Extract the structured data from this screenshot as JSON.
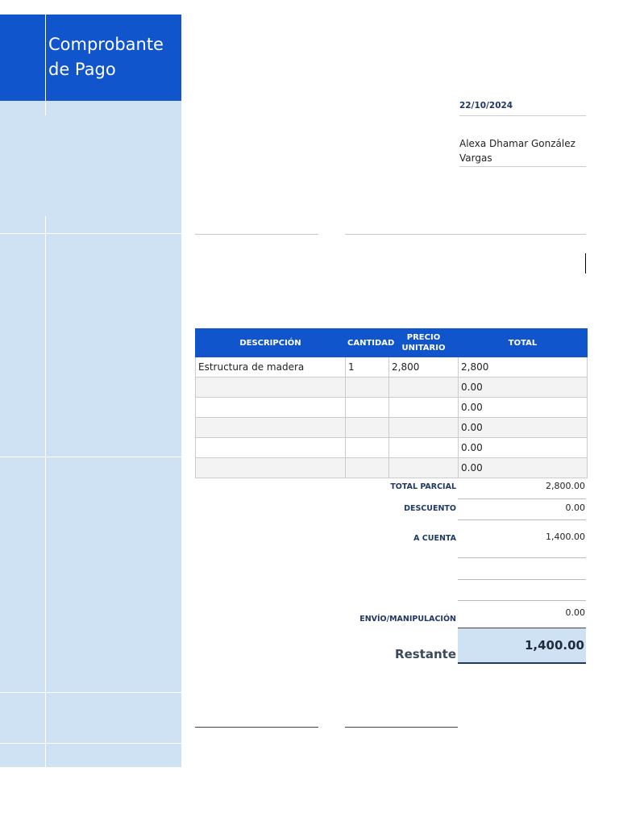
{
  "sidebar": {
    "title": "Comprobante de Pago"
  },
  "header": {
    "date": "22/10/2024",
    "customer_name": "Alexa Dhamar González Vargas"
  },
  "items_table": {
    "columns": [
      "DESCRIPCIÓN",
      "CANTIDAD",
      "PRECIO UNITARIO",
      "TOTAL"
    ],
    "rows": [
      {
        "description": "Estructura de madera",
        "quantity": "1",
        "unit_price": "2,800",
        "total": "2,800"
      },
      {
        "description": "",
        "quantity": "",
        "unit_price": "",
        "total": "0.00"
      },
      {
        "description": "",
        "quantity": "",
        "unit_price": "",
        "total": "0.00"
      },
      {
        "description": "",
        "quantity": "",
        "unit_price": "",
        "total": "0.00"
      },
      {
        "description": "",
        "quantity": "",
        "unit_price": "",
        "total": "0.00"
      },
      {
        "description": "",
        "quantity": "",
        "unit_price": "",
        "total": "0.00"
      }
    ]
  },
  "summary": {
    "subtotal_label": "TOTAL PARCIAL",
    "subtotal_value": "2,800.00",
    "discount_label": "DESCUENTO",
    "discount_value": "0.00",
    "on_account_label": "A CUENTA",
    "on_account_value": "1,400.00",
    "shipping_label": "ENVÍO/MANIPULACIÓN",
    "shipping_value": "0.00",
    "remaining_label": "Restante",
    "remaining_value": "1,400.00"
  },
  "colors": {
    "accent": "#1155cc",
    "light_accent": "#cfe2f3",
    "label_text": "#1f3864"
  }
}
